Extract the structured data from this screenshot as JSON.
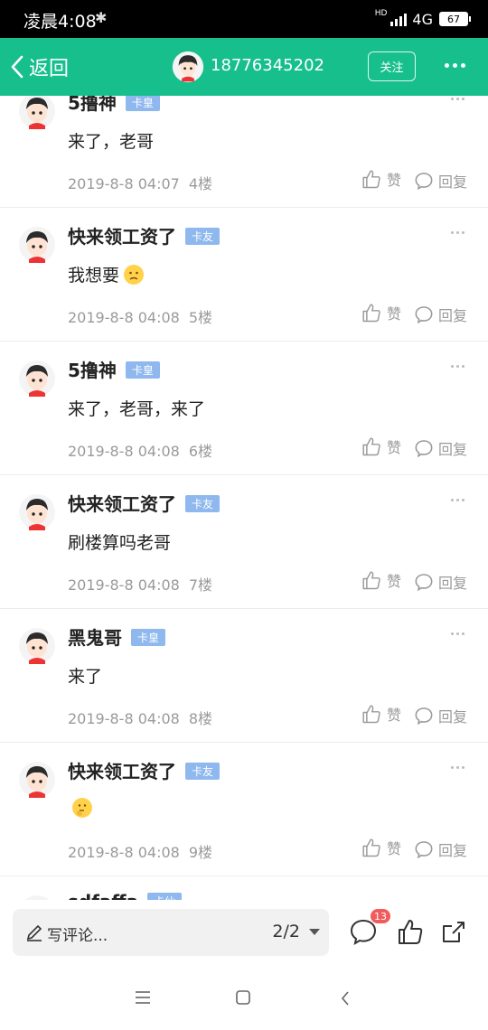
{
  "status_bar": {
    "time": "凌晨4:08",
    "bluetooth_icon": "bluetooth-icon",
    "hd_label": "HD",
    "network": "4G",
    "battery": "67"
  },
  "nav": {
    "back_label": "返回",
    "title": "18776345202",
    "follow_label": "关注",
    "accent_color": "#17bf8d"
  },
  "comments": [
    {
      "name": "5撸神",
      "badge": "卡皇",
      "text": "来了，老哥",
      "emoji": "",
      "date": "2019-8-8 04:07",
      "floor": "4楼",
      "like_label": "赞",
      "reply_label": "回复"
    },
    {
      "name": "快来领工资了",
      "badge": "卡友",
      "text": "我想要",
      "emoji": "worried-face-emoji",
      "date": "2019-8-8 04:08",
      "floor": "5楼",
      "like_label": "赞",
      "reply_label": "回复"
    },
    {
      "name": "5撸神",
      "badge": "卡皇",
      "text": "来了，老哥，来了",
      "emoji": "",
      "date": "2019-8-8 04:08",
      "floor": "6楼",
      "like_label": "赞",
      "reply_label": "回复"
    },
    {
      "name": "快来领工资了",
      "badge": "卡友",
      "text": "刷楼算吗老哥",
      "emoji": "",
      "date": "2019-8-8 04:08",
      "floor": "7楼",
      "like_label": "赞",
      "reply_label": "回复"
    },
    {
      "name": "黑鬼哥",
      "badge": "卡皇",
      "text": "来了",
      "emoji": "",
      "date": "2019-8-8 04:08",
      "floor": "8楼",
      "like_label": "赞",
      "reply_label": "回复"
    },
    {
      "name": "快来领工资了",
      "badge": "卡友",
      "text": "",
      "emoji": "thinking-face-emoji",
      "date": "2019-8-8 04:08",
      "floor": "9楼",
      "like_label": "赞",
      "reply_label": "回复"
    },
    {
      "name": "sdfaffa",
      "badge": "卡仙",
      "text": "",
      "emoji": "",
      "date": "",
      "floor": "",
      "like_label": "",
      "reply_label": ""
    }
  ],
  "bottom_bar": {
    "write_placeholder": "写评论...",
    "page_indicator": "2/2",
    "comment_count": "13",
    "icons": [
      "comment-icon",
      "thumbs-up-icon",
      "share-icon"
    ]
  },
  "system_nav": {
    "icons": [
      "menu-icon",
      "home-icon",
      "back-icon"
    ]
  }
}
